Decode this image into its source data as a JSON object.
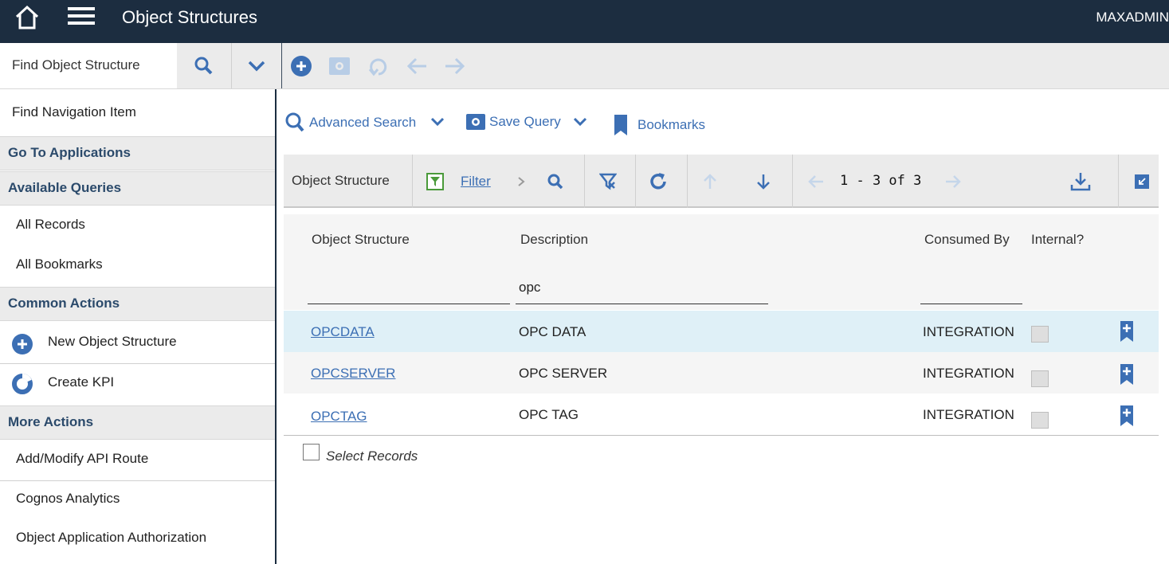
{
  "header": {
    "title": "Object Structures",
    "user": "MAXADMIN"
  },
  "toolbar": {
    "find_label": "Find Object Structure"
  },
  "sidebar": {
    "find_nav": "Find Navigation Item",
    "go_to_apps": "Go To Applications",
    "available_queries": "Available Queries",
    "queries": [
      "All Records",
      "All Bookmarks"
    ],
    "common_actions": "Common Actions",
    "common": [
      "New Object Structure",
      "Create KPI"
    ],
    "more_actions": "More Actions",
    "more": [
      "Add/Modify API Route",
      "Cognos Analytics",
      "Object Application Authorization"
    ]
  },
  "links": {
    "advanced_search": "Advanced Search",
    "save_query": "Save Query",
    "bookmarks": "Bookmarks"
  },
  "list_toolbar": {
    "title": "Object Structure",
    "filter": "Filter",
    "pagination": "1 - 3 of 3"
  },
  "table": {
    "columns": [
      "Object Structure",
      "Description",
      "Consumed By",
      "Internal?"
    ],
    "filter_description": "opc",
    "rows": [
      {
        "name": "OPCDATA",
        "description": "OPC DATA",
        "consumed_by": "INTEGRATION",
        "internal": false
      },
      {
        "name": "OPCSERVER",
        "description": "OPC SERVER",
        "consumed_by": "INTEGRATION",
        "internal": false
      },
      {
        "name": "OPCTAG",
        "description": "OPC TAG",
        "consumed_by": "INTEGRATION",
        "internal": false
      }
    ],
    "select_records": "Select Records"
  },
  "colors": {
    "header_bg": "#1c2d40",
    "accent": "#3c6fb4",
    "selected_row": "#dff0f7",
    "section_text": "#2b4a6b"
  }
}
